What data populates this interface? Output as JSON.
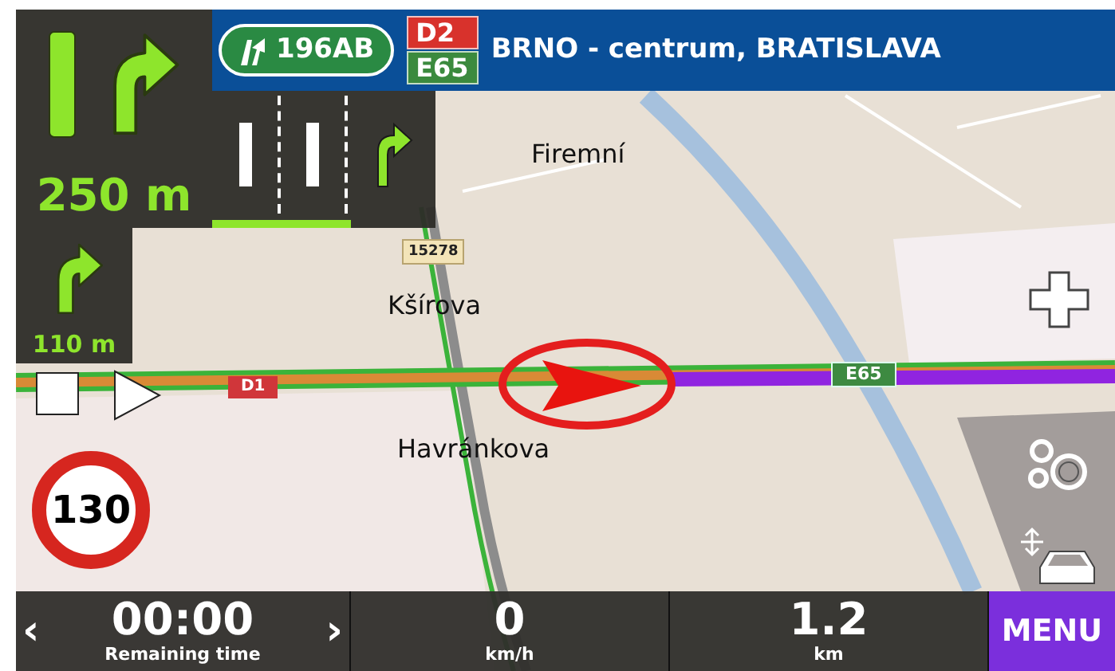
{
  "maneuver": {
    "distance": "250 m"
  },
  "lanes": {
    "level": 0.62,
    "items": [
      {
        "kind": "straight",
        "selected": false
      },
      {
        "kind": "straight",
        "selected": false
      },
      {
        "kind": "right",
        "selected": true
      }
    ]
  },
  "sign": {
    "exit": "196AB",
    "shields": [
      {
        "text": "D2",
        "color": "#d8322c"
      },
      {
        "text": "E65",
        "color": "#3b8a3e"
      }
    ],
    "destination": "BRNO - centrum, BRATISLAVA"
  },
  "next_maneuver": {
    "distance": "110 m"
  },
  "map": {
    "labels": [
      {
        "text": "Firemní"
      },
      {
        "text": "Kšírova"
      },
      {
        "text": "Havránkova"
      }
    ],
    "road_shields": [
      {
        "text": "15278",
        "kind": "local"
      },
      {
        "text": "D1",
        "kind": "motorway"
      },
      {
        "text": "E65",
        "kind": "euro"
      }
    ]
  },
  "speed_limit": "130",
  "status_bar": {
    "prev": "‹",
    "next": "›",
    "items": [
      {
        "value": "00:00",
        "label": "Remaining time"
      },
      {
        "value": "0",
        "label": "km/h"
      },
      {
        "value": "1.2",
        "label": "km"
      }
    ],
    "menu": "MENU"
  }
}
